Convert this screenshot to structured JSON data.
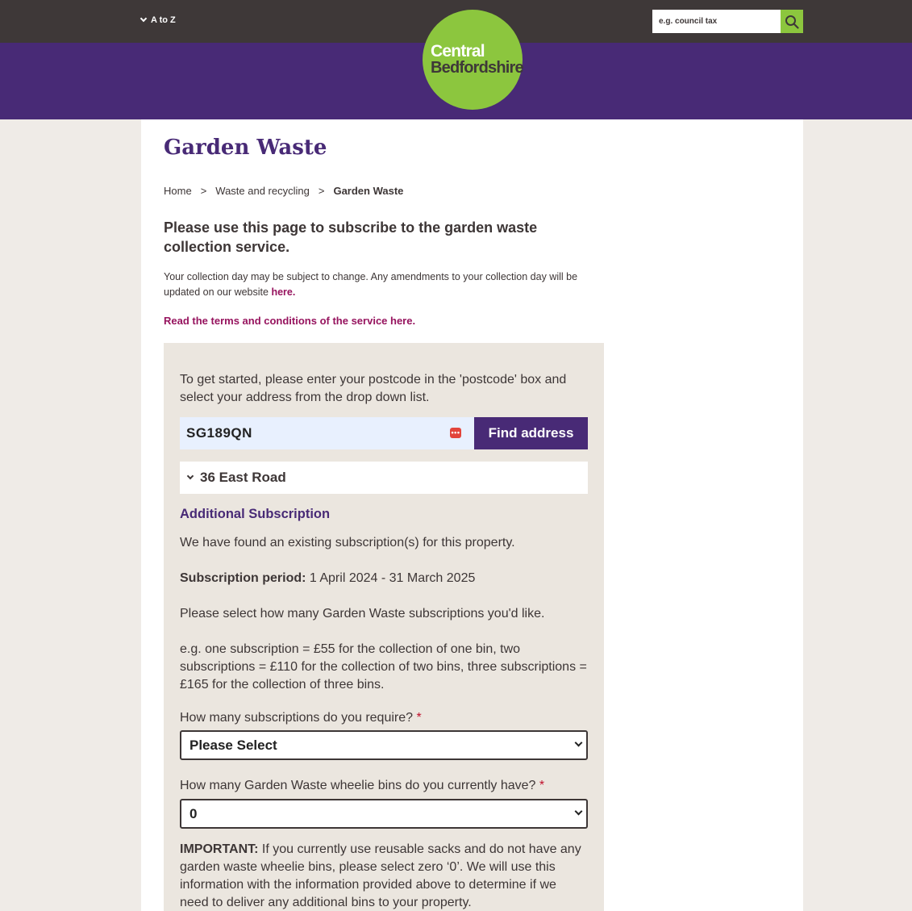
{
  "header": {
    "atoz_label": "A to Z",
    "logo_line1": "Central",
    "logo_line2": "Bedfordshire",
    "search_placeholder": "e.g. council tax"
  },
  "page": {
    "title": "Garden Waste",
    "breadcrumbs": [
      "Home",
      ">",
      "Waste and recycling",
      ">",
      "Garden Waste"
    ],
    "intro": "Please use this page to subscribe to the garden waste collection service.",
    "note_text": "Your collection day may be subject to change. Any amendments to your collection day will be updated on our website ",
    "note_link": "here.",
    "terms_link": "Read the terms and conditions of the service here."
  },
  "form": {
    "instructions": "To get started, please enter your postcode in the 'postcode' box and select your address from the drop down list.",
    "postcode_value": "SG189QN",
    "find_button": "Find address",
    "address_selected": "36 East Road",
    "section_heading": "Additional Subscription",
    "existing_text": "We have found an existing subscription(s) for this property.",
    "period_label": "Subscription period:",
    "period_value": " 1 April 2024 - 31 March 2025",
    "select_prompt": "Please select how many Garden Waste subscriptions you'd like.",
    "example_text": "e.g. one subscription = £55 for the collection of one bin, two subscriptions = £110 for the collection of two bins, three subscriptions = £165 for the collection of three bins.",
    "q1_label": "How many subscriptions do you require?",
    "q1_value": "Please Select",
    "q2_label": "How many Garden Waste wheelie bins do you currently have?",
    "q2_value": "0",
    "required_mark": "*",
    "important_label": "IMPORTANT:",
    "important_text": " If you currently use reusable sacks and do not have any garden waste wheelie bins, please select zero ‘0’. We will use this information with the information provided above to determine if we need to deliver any additional bins to your property."
  },
  "colors": {
    "brand_purple": "#482a76",
    "brand_green": "#8cc63e",
    "link_magenta": "#96135e",
    "header_dark": "#3e3838"
  }
}
